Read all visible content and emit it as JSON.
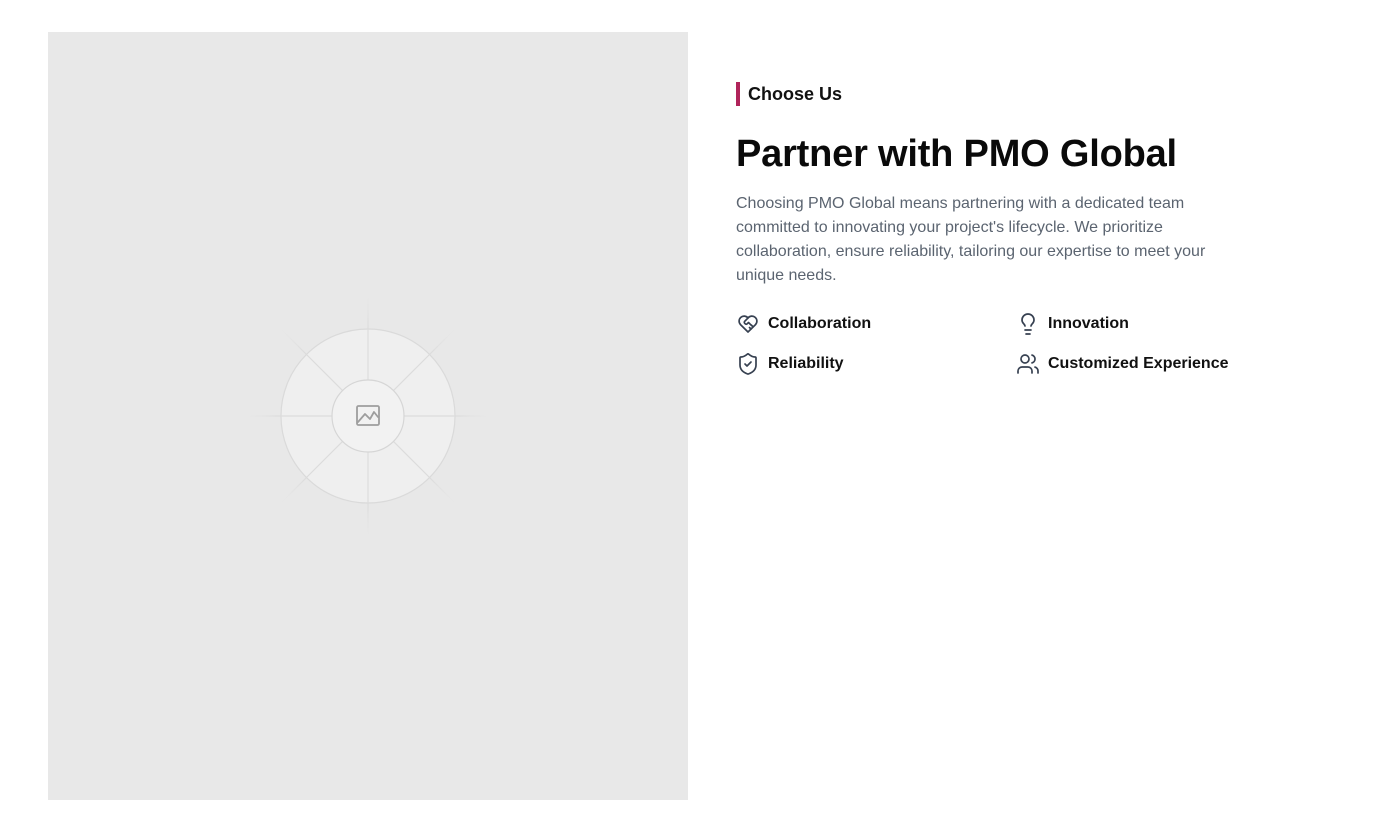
{
  "section": {
    "eyebrow": "Choose Us",
    "title": "Partner with PMO Global",
    "description": "Choosing PMO Global means partnering with a dedicated team committed to innovating your project's lifecycle. We prioritize collaboration, ensure reliability, tailoring our expertise to meet your unique needs.",
    "accent_color": "#b0245a"
  },
  "image_placeholder": {
    "icon": "image-placeholder-icon",
    "background": "#e8e8e8"
  },
  "features": [
    {
      "label": "Collaboration",
      "icon": "handshake-icon"
    },
    {
      "label": "Innovation",
      "icon": "lightbulb-icon"
    },
    {
      "label": "Reliability",
      "icon": "shield-check-icon"
    },
    {
      "label": "Customized Experience",
      "icon": "users-icon"
    }
  ]
}
